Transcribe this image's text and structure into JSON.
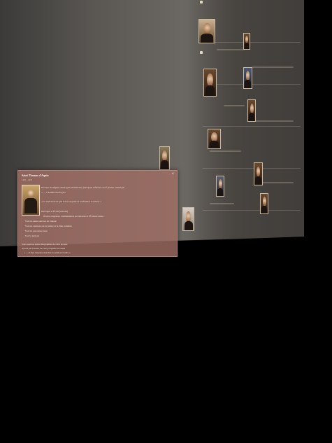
{
  "popup": {
    "title": "Saint Thomas d'Aquin",
    "subtitle": "1225 – 1274",
    "lines": [
      "Docteur de l'Église, théologien dominicain, principale référence de la pensée catholique",
      "« … » Summa theologica",
      "« Le seul droit est que la loi soit juste et conforme à la raison. »",
      "Ouvrages et Écrits (extraits)",
      "Œuvres majeures, commentaires sur Aristote et l'Écriture sainte",
      "· Voir les autres œuvres de l'auteur",
      "· Voir les citations sur la justice et le bien commun",
      "· Voir les personnes liées",
      "· Voir la période",
      "Voir aussi les autres biographies de cette époque",
      "Ajouté par l'auteur de l'encyclopédie et validé",
      "« … Il faut toujours chercher la vérité et l'ordre »"
    ],
    "close_icon": "close-icon"
  },
  "colors": {
    "popup_bg": "#a06e64",
    "background": "#000000",
    "timeline_plane": "#5a5753"
  }
}
